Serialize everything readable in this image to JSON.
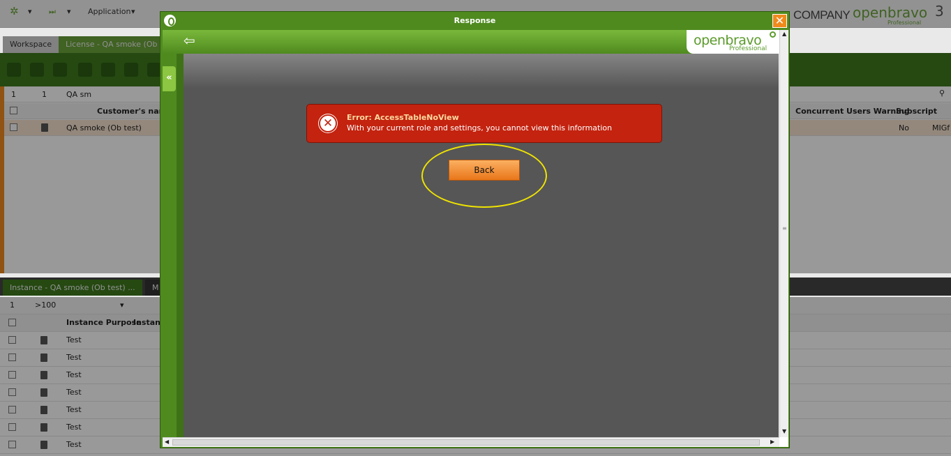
{
  "topbar": {
    "application_label": "Application",
    "company": "COMPANY",
    "brand": "openbravo",
    "brand_sub": "Professional",
    "brand_version": "3"
  },
  "tabs": {
    "workspace": "Workspace",
    "license": "License - QA smoke (Ob"
  },
  "top_grid": {
    "filter_row": [
      "1",
      "1",
      "QA sm"
    ],
    "header": {
      "customer": "Customer's name",
      "concurrent": "Concurrent Users Warning",
      "subscription": "Subscript"
    },
    "row": {
      "customer": "QA smoke (Ob test)",
      "concurrent": "No",
      "subscription": "MIGf"
    }
  },
  "sub_tabs": {
    "instance": "Instance - QA smoke (Ob test) ...",
    "other": "M"
  },
  "bottom_grid": {
    "filter_row": [
      "1",
      ">100"
    ],
    "header": {
      "purpose": "Instance Purpose",
      "instance": "Instanc"
    },
    "rows": [
      "Test",
      "Test",
      "Test",
      "Test",
      "Test",
      "Test",
      "Test"
    ]
  },
  "popup": {
    "title": "Response",
    "brand": "openbravo",
    "brand_sub": "Professional",
    "error_title": "Error: AccessTableNoView",
    "error_message": "With your current role and settings, you cannot view this information",
    "back_label": "Back"
  },
  "colors": {
    "brand_green": "#4f8a1f",
    "error_red": "#c3230f",
    "button_orange": "#f08a1c",
    "highlight_yellow": "#f0e400"
  }
}
